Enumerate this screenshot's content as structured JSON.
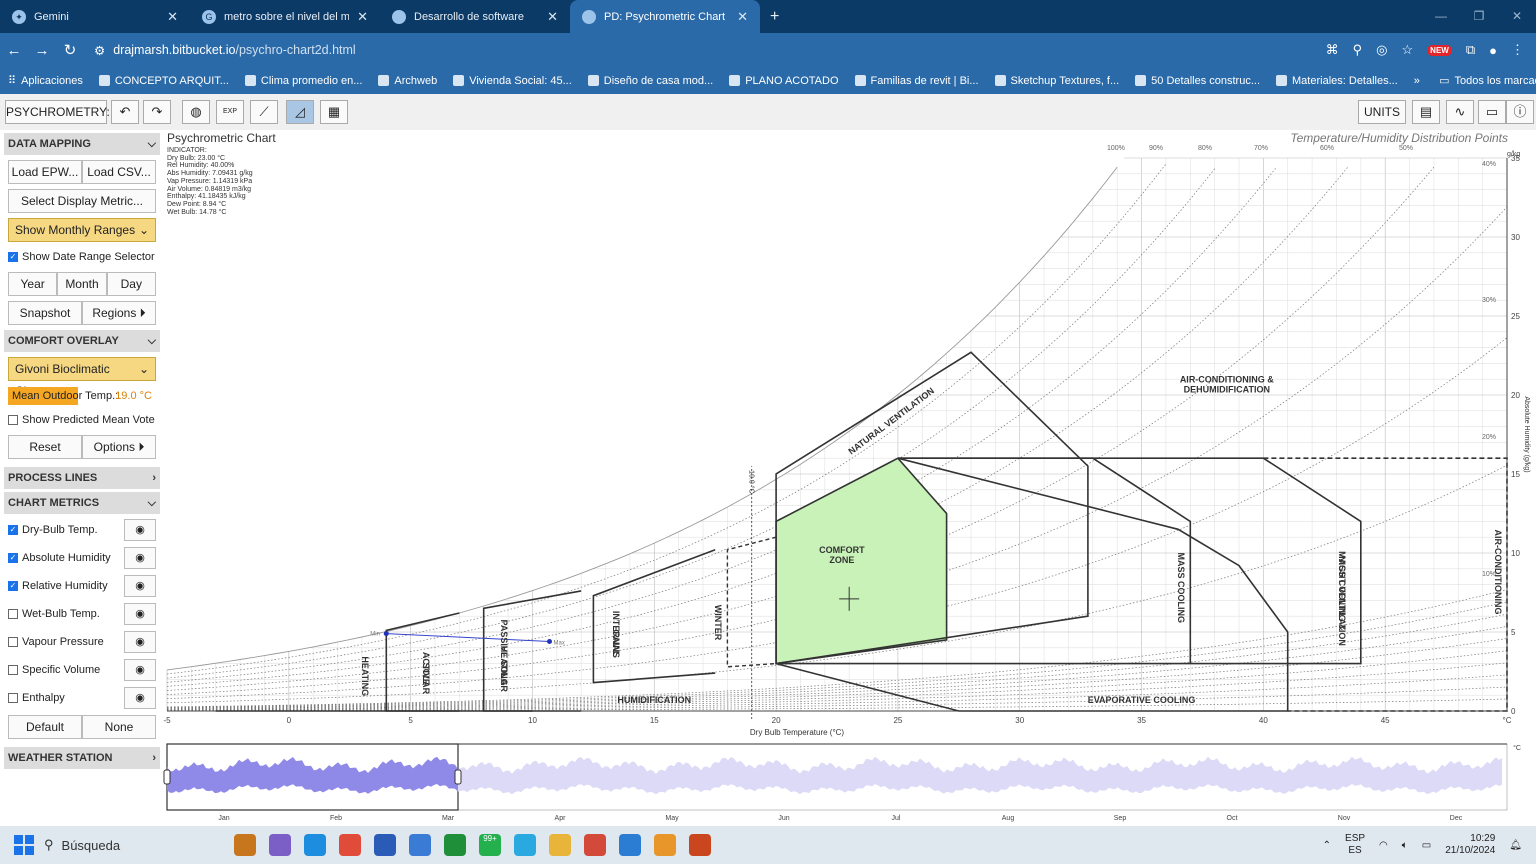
{
  "browser": {
    "tabs": [
      {
        "title": "Gemini",
        "active": false
      },
      {
        "title": "metro sobre el nivel del mar - B",
        "active": false
      },
      {
        "title": "Desarrollo de software",
        "active": false
      },
      {
        "title": "PD: Psychrometric Chart",
        "active": true
      }
    ],
    "url_host": "drajmarsh.bitbucket.io",
    "url_path": "/psychro-chart2d.html",
    "new_badge": "NEW",
    "bookmarks": [
      "Aplicaciones",
      "CONCEPTO ARQUIT...",
      "Clima promedio en...",
      "Archweb",
      "Vivienda Social: 45...",
      "Diseño de casa mod...",
      "PLANO ACOTADO",
      "Familias de revit | Bi...",
      "Sketchup Textures, f...",
      "50 Detalles construc...",
      "Materiales: Detalles..."
    ],
    "all_bookmarks": "Todos los marcadores"
  },
  "toolbar": {
    "title": "PSYCHROMETRY:",
    "undo": "↶",
    "redo": "↷",
    "units": "UNITS",
    "exp": "EXP"
  },
  "sidebar": {
    "data_mapping": {
      "header": "DATA MAPPING",
      "load_epw": "Load EPW...",
      "load_csv": "Load CSV...",
      "select_metric": "Select Display Metric...",
      "monthly": "Show Monthly Ranges",
      "date_range": "Show Date Range Selector",
      "year": "Year",
      "month": "Month",
      "day": "Day",
      "snapshot": "Snapshot",
      "regions": "Regions ⏵"
    },
    "comfort_overlay": {
      "header": "COMFORT OVERLAY",
      "chart": "Givoni Bioclimatic Chart",
      "mean_temp_label": "Mean Outdoor Temp.:",
      "mean_temp_value": "19.0 °C",
      "pmv": "Show Predicted Mean Vote",
      "reset": "Reset",
      "options": "Options ⏵"
    },
    "process_lines": {
      "header": "PROCESS LINES"
    },
    "chart_metrics": {
      "header": "CHART METRICS",
      "items": [
        {
          "label": "Dry-Bulb Temp.",
          "checked": true
        },
        {
          "label": "Absolute Humidity",
          "checked": true
        },
        {
          "label": "Relative Humidity",
          "checked": true
        },
        {
          "label": "Wet-Bulb Temp.",
          "checked": false
        },
        {
          "label": "Vapour Pressure",
          "checked": false
        },
        {
          "label": "Specific Volume",
          "checked": false
        },
        {
          "label": "Enthalpy",
          "checked": false
        }
      ],
      "default": "Default",
      "none": "None"
    },
    "weather_station": {
      "header": "WEATHER STATION"
    }
  },
  "chart": {
    "title": "Psychrometric Chart",
    "right_title": "Temperature/Humidity Distribution Points",
    "indicator": [
      "INDICATOR:",
      "Dry Bulb: 23.00 °C",
      "Rel Humidity: 40.00%",
      "Abs Humidity: 7.09431 g/kg",
      "Vap Pressure: 1.14319 kPa",
      "Air Volume: 0.84819 m3/kg",
      "Enthalpy: 41.18435 kJ/kg",
      "Dew Point: 8.94 °C",
      "Wet Bulb: 14.78 °C"
    ],
    "x_label": "Dry Bulb Temperature (°C)",
    "x_unit": "°C",
    "y_label": "Absolute Humidity (g/kg)",
    "y_unit": "g/kg",
    "x_ticks": [
      -5,
      0,
      5,
      10,
      15,
      20,
      25,
      30,
      35,
      40,
      45
    ],
    "y_ticks": [
      0,
      5,
      10,
      15,
      20,
      25,
      30,
      35
    ],
    "rh_labels": [
      "100%",
      "90%",
      "80%",
      "70%",
      "60%",
      "50%",
      "40%",
      "30%",
      "20%",
      "10%"
    ],
    "mean_line_label": "19.0 °C",
    "zones": {
      "comfort": "COMFORT ZONE",
      "natural_vent": "NATURAL VENTILATION",
      "ac_dehum": "AIR-CONDITIONING & DEHUMIDIFICATION",
      "winter": "WINTER",
      "internal_gains": "INTERNAL GAINS",
      "passive_solar": "PASSIVE SOLAR HEATING",
      "active_solar": "ACTIVE SOLAR",
      "heating": "HEATING",
      "humidification": "HUMIDIFICATION",
      "evaporative": "EVAPORATIVE COOLING",
      "mass_cooling": "MASS COOLING",
      "mass_night": "MASS COOLING & NIGHT VENTILATION",
      "ac": "AIR-CONDITIONING"
    },
    "range_min_label": "Min",
    "range_max_label": "Max",
    "months": [
      "Jan",
      "Feb",
      "Mar",
      "Apr",
      "May",
      "Jun",
      "Jul",
      "Aug",
      "Sep",
      "Oct",
      "Nov",
      "Dec"
    ],
    "timeline_unit": "°C"
  },
  "chart_data": {
    "type": "line",
    "title": "Psychrometric Chart",
    "xlabel": "Dry Bulb Temperature (°C)",
    "ylabel": "Absolute Humidity (g/kg)",
    "xlim": [
      -5,
      50
    ],
    "ylim": [
      0,
      35
    ],
    "rh_curves": [
      100,
      90,
      80,
      70,
      60,
      50,
      40,
      30,
      20,
      10
    ],
    "selected_range": {
      "min": {
        "x": 4,
        "y": 4.9
      },
      "max": {
        "x": 10.7,
        "y": 4.4
      }
    },
    "comfort_zone": [
      [
        20,
        3
      ],
      [
        20,
        12
      ],
      [
        25,
        16
      ],
      [
        27,
        12.5
      ],
      [
        27,
        4.5
      ]
    ]
  },
  "taskbar": {
    "search": "Búsqueda",
    "lang": "ESP",
    "lang2": "ES",
    "time": "10:29",
    "date": "21/10/2024",
    "badge": "99+"
  }
}
